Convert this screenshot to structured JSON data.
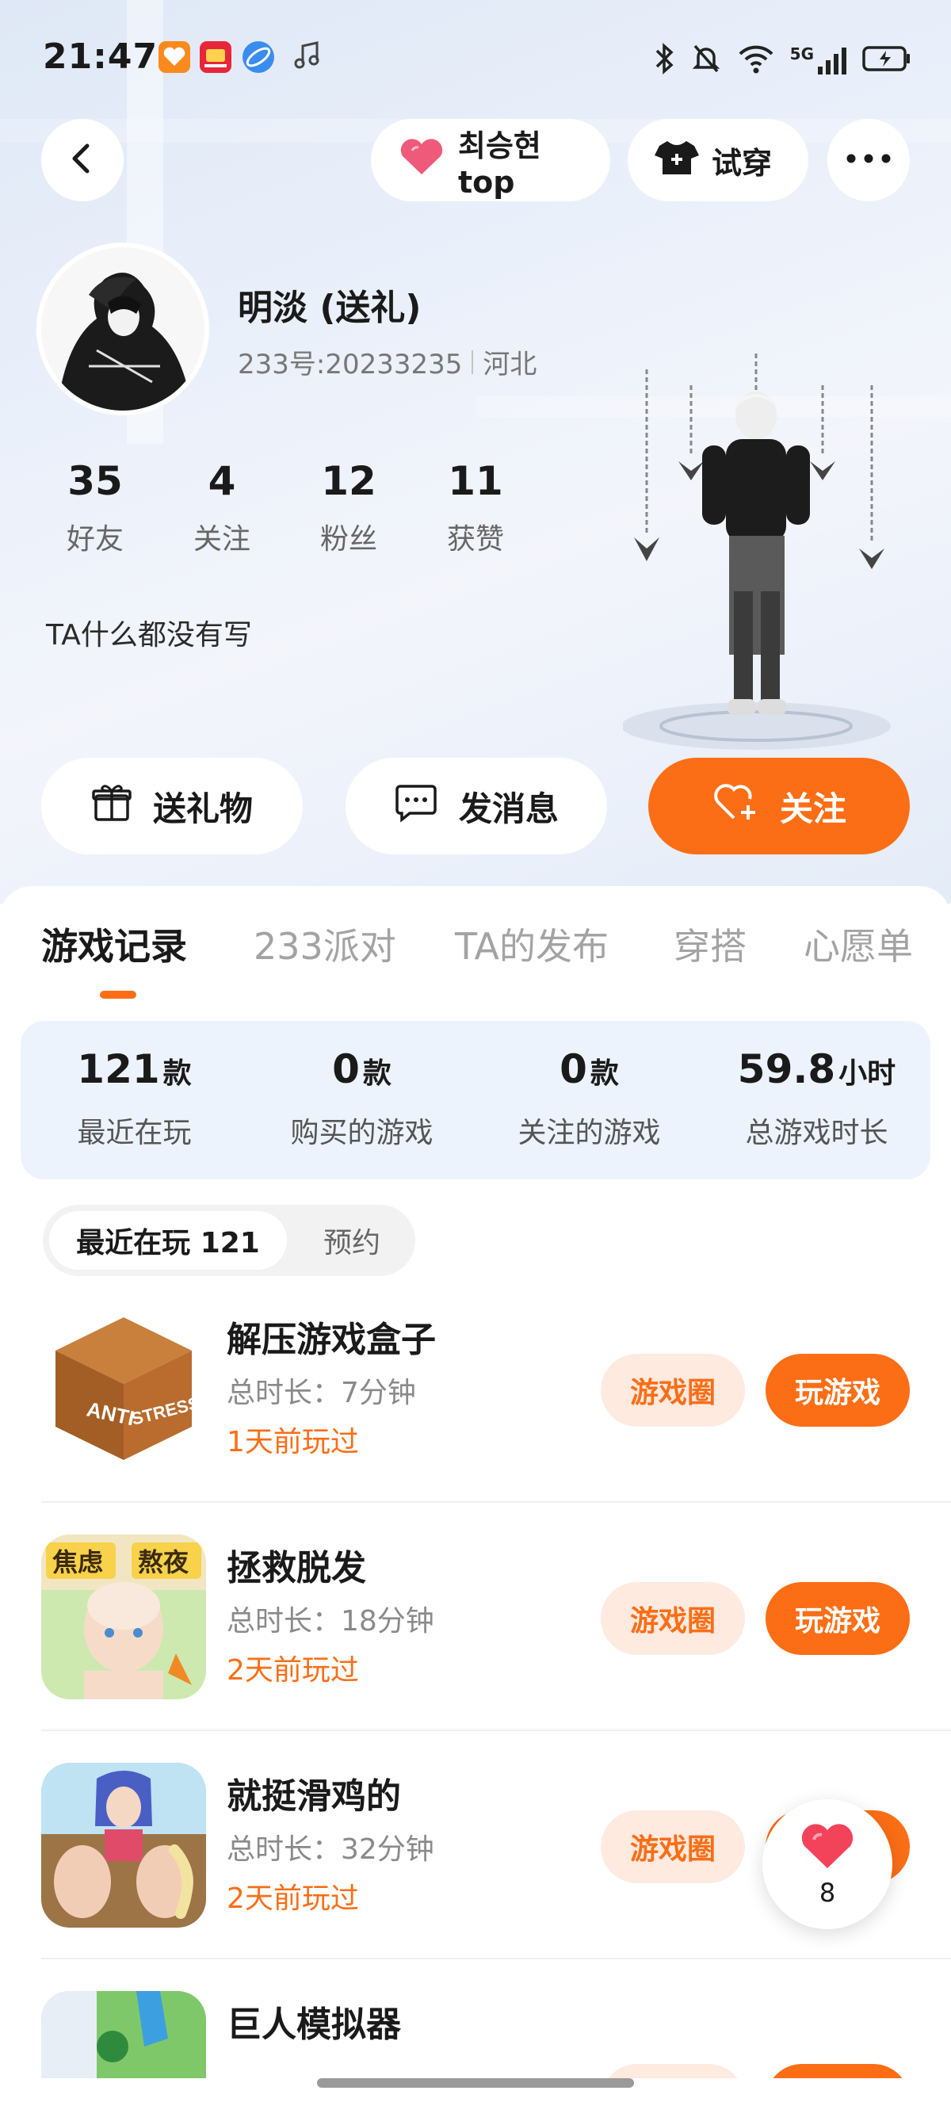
{
  "status_bar": {
    "time": "21:47",
    "app_icons": [
      "heart-app-icon",
      "video-app-icon",
      "browser-app-icon",
      "music-note-icon"
    ],
    "network_label": "5G"
  },
  "nav": {
    "back_icon": "chevron-left-icon",
    "heart_tag_label": "최승현top",
    "try_on_label": "试穿",
    "more_icon": "more-dots-icon"
  },
  "profile": {
    "name": "明淡 (送礼)",
    "id_text": "233号:20233235",
    "region": "河北",
    "bio": "TA什么都没有写"
  },
  "stats": [
    {
      "value": "35",
      "label": "好友"
    },
    {
      "value": "4",
      "label": "关注"
    },
    {
      "value": "12",
      "label": "粉丝"
    },
    {
      "value": "11",
      "label": "获赞"
    }
  ],
  "actions": {
    "gift_label": "送礼物",
    "message_label": "发消息",
    "follow_label": "关注"
  },
  "tabs": [
    "游戏记录",
    "233派对",
    "TA的发布",
    "穿搭",
    "心愿单"
  ],
  "active_tab": "游戏记录",
  "summary": [
    {
      "value": "121",
      "unit": "款",
      "label": "最近在玩"
    },
    {
      "value": "0",
      "unit": "款",
      "label": "购买的游戏"
    },
    {
      "value": "0",
      "unit": "款",
      "label": "关注的游戏"
    },
    {
      "value": "59.8",
      "unit": "小时",
      "label": "总游戏时长"
    }
  ],
  "subtabs": {
    "recent_label": "最近在玩 121",
    "reserve_label": "预约"
  },
  "games": [
    {
      "name": "解压游戏盒子",
      "duration": "总时长：7分钟",
      "last_played": "1天前玩过",
      "circle_label": "游戏圈",
      "play_label": "玩游戏",
      "icon_text": [
        "ANTI",
        "STRESS"
      ]
    },
    {
      "name": "拯救脱发",
      "duration": "总时长：18分钟",
      "last_played": "2天前玩过",
      "circle_label": "游戏圈",
      "play_label": "玩游戏",
      "icon_text": [
        "焦虑",
        "熬夜"
      ]
    },
    {
      "name": "就挺滑鸡的",
      "duration": "总时长：32分钟",
      "last_played": "2天前玩过",
      "circle_label": "游戏圈",
      "play_label": "玩游戏"
    },
    {
      "name": "巨人模拟器"
    }
  ],
  "float_like": {
    "count": "8"
  },
  "colors": {
    "accent": "#fb6e16",
    "accent_light": "#ffeae0",
    "summary_bg": "#edf3fd",
    "heart": "#f2435b"
  }
}
